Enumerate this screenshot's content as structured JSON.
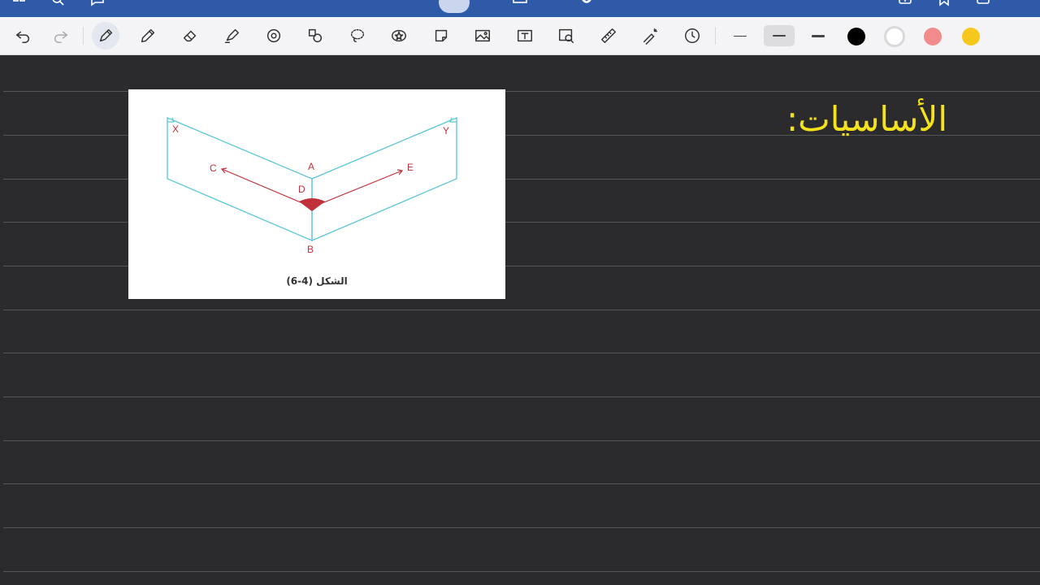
{
  "topbar": {
    "icons": [
      "grid-icon",
      "search-icon",
      "comment-icon",
      "pen-mode-icon",
      "presentation-icon",
      "microphone-icon",
      "add-page-icon",
      "bookmark-icon",
      "share-icon"
    ]
  },
  "toolbar": {
    "tools": [
      "undo-icon",
      "redo-icon",
      "pen-icon",
      "pencil-icon",
      "eraser-icon",
      "highlighter-icon",
      "shape-icon",
      "elements-icon",
      "lasso-icon",
      "star-icon",
      "sticker-icon",
      "image-icon",
      "text-icon",
      "scan-icon",
      "ruler-icon",
      "laser-pointer-icon",
      "timer-icon"
    ],
    "stroke_widths": [
      "thin",
      "medium",
      "thick"
    ],
    "selected_stroke": "medium",
    "colors": [
      "#000000",
      "#ffffff",
      "#f28b8b",
      "#f7c81c"
    ]
  },
  "page": {
    "heading": "الأساسيات:",
    "heading_color": "#f4e21c"
  },
  "figure": {
    "caption": "الشكل (4-6)",
    "labels": {
      "x": "X",
      "y": "Y",
      "a": "A",
      "b": "B",
      "c": "C",
      "d": "D",
      "e": "E"
    },
    "line_color": "#5ac6d6",
    "arrow_color": "#c0303a"
  }
}
